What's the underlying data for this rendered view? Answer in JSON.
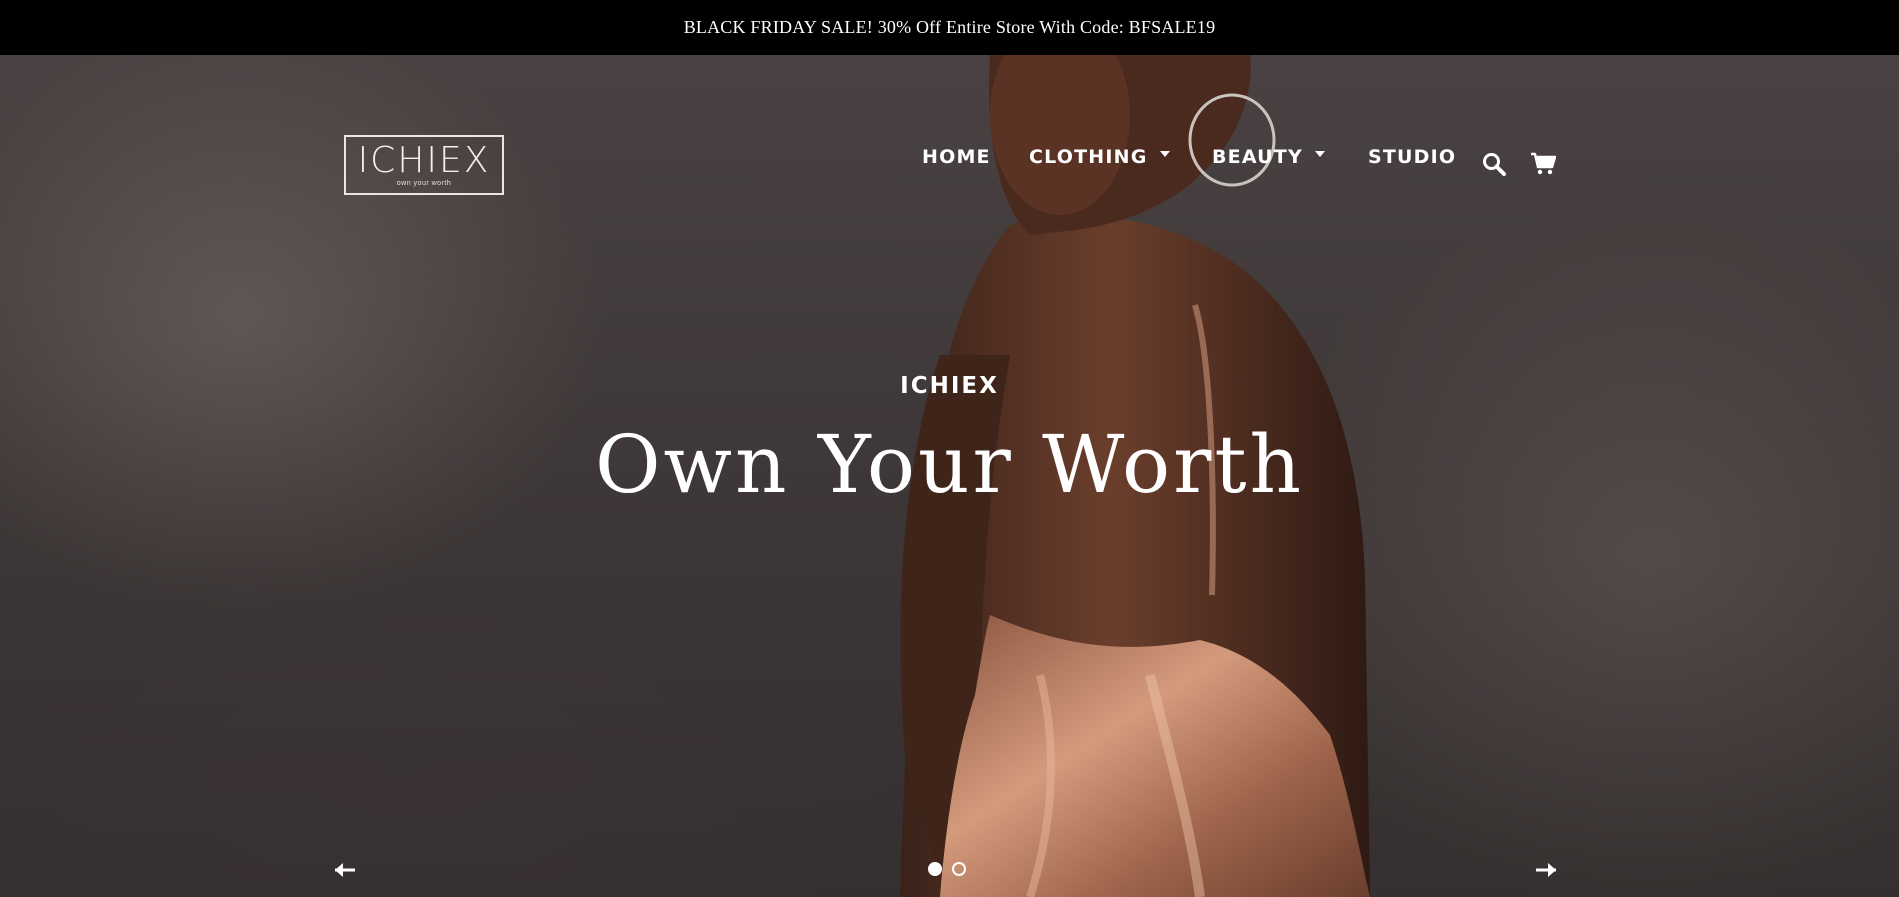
{
  "announcement": {
    "text": "BLACK FRIDAY SALE! 30% Off Entire Store With Code: BFSALE19"
  },
  "logo": {
    "name": "ICHIEX",
    "tagline": "own your worth"
  },
  "nav": {
    "items": [
      {
        "label": "HOME",
        "has_dropdown": false
      },
      {
        "label": "CLOTHING",
        "has_dropdown": true
      },
      {
        "label": "BEAUTY",
        "has_dropdown": true
      },
      {
        "label": "STUDIO",
        "has_dropdown": false
      }
    ],
    "icons": [
      "search-icon",
      "cart-icon"
    ]
  },
  "hero": {
    "subheading": "ICHIEX",
    "heading": "Own Your Worth",
    "slides": {
      "count": 2,
      "active": 1
    },
    "controls": [
      "arrow-left-icon",
      "arrow-right-icon"
    ]
  },
  "colors": {
    "announcement_bg": "#000000",
    "hero_bg": "#3f3838",
    "text": "#ffffff",
    "dress": "#b27a62"
  }
}
